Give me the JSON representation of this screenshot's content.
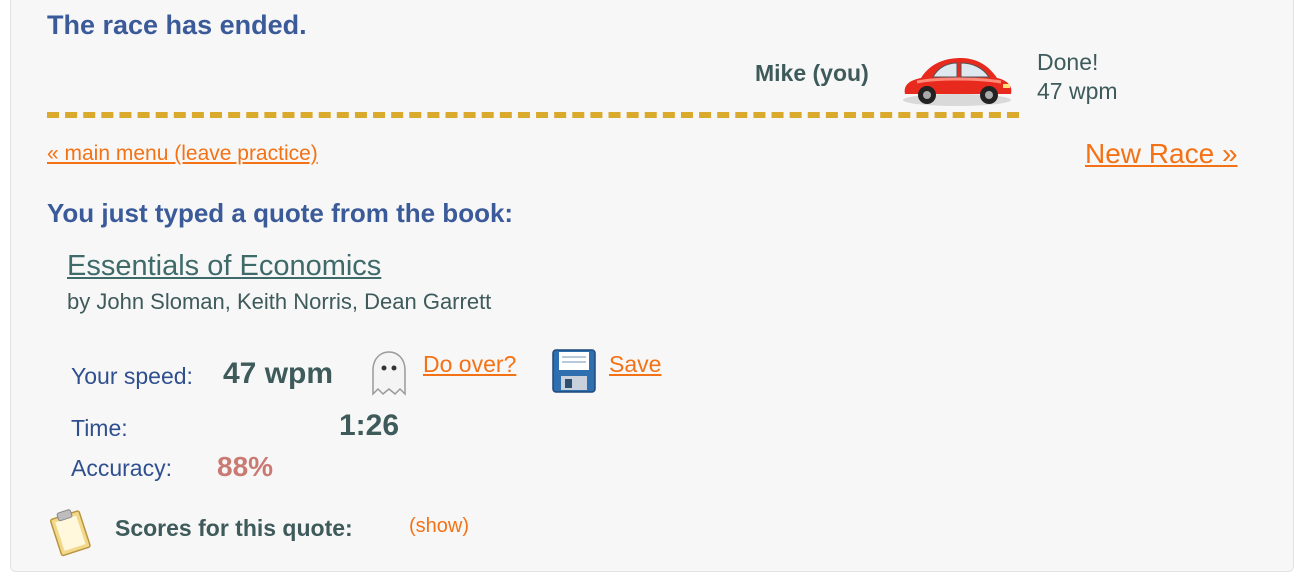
{
  "status": {
    "title": "The race has ended."
  },
  "racer": {
    "name": "Mike (you)",
    "state": "Done!",
    "wpm": "47 wpm",
    "car_color": "#e8291d"
  },
  "nav": {
    "main_menu": "« main menu (leave practice)",
    "new_race": "New Race »"
  },
  "quote": {
    "heading": "You just typed a quote from the book:",
    "book_title": "Essentials of Economics",
    "authors": "by John Sloman, Keith Norris, Dean Garrett"
  },
  "results": {
    "speed_label": "Your speed:",
    "speed_value": "47 wpm",
    "do_over": "Do over?",
    "save": "Save",
    "time_label": "Time:",
    "time_value": "1:26",
    "accuracy_label": "Accuracy:",
    "accuracy_value": "88%"
  },
  "scores": {
    "label": "Scores for this quote:",
    "show": "(show)"
  },
  "colors": {
    "accent_orange": "#f47216",
    "heading_blue": "#3a5a99",
    "accuracy": "#c97b73",
    "track": "#d9aa2c"
  },
  "icons": [
    "car-icon",
    "ghost-icon",
    "floppy-disk-icon",
    "clipboard-icon"
  ]
}
